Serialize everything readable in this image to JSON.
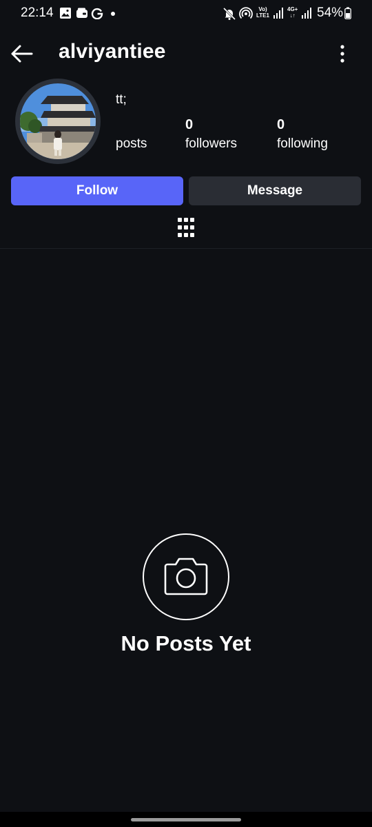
{
  "status_bar": {
    "time": "22:14",
    "battery": "54%",
    "icons": [
      "gallery-icon",
      "wallet-icon",
      "google-icon",
      "notification-dot",
      "mute-icon",
      "hotspot-icon",
      "volte-icon",
      "signal-icon",
      "4g-icon",
      "signal-icon",
      "battery-icon"
    ],
    "volte_label": "Vo)\nLTE1",
    "network_label": "4G+"
  },
  "header": {
    "username": "alviyantiee"
  },
  "profile": {
    "bio": "tt;",
    "stats": {
      "posts_label": "posts",
      "followers_value": "0",
      "followers_label": "followers",
      "following_value": "0",
      "following_label": "following"
    }
  },
  "actions": {
    "follow_label": "Follow",
    "message_label": "Message"
  },
  "empty_state": {
    "text": "No Posts Yet"
  },
  "colors": {
    "background": "#0e1014",
    "follow_button": "#5865f8",
    "message_button": "#2a2d34"
  }
}
